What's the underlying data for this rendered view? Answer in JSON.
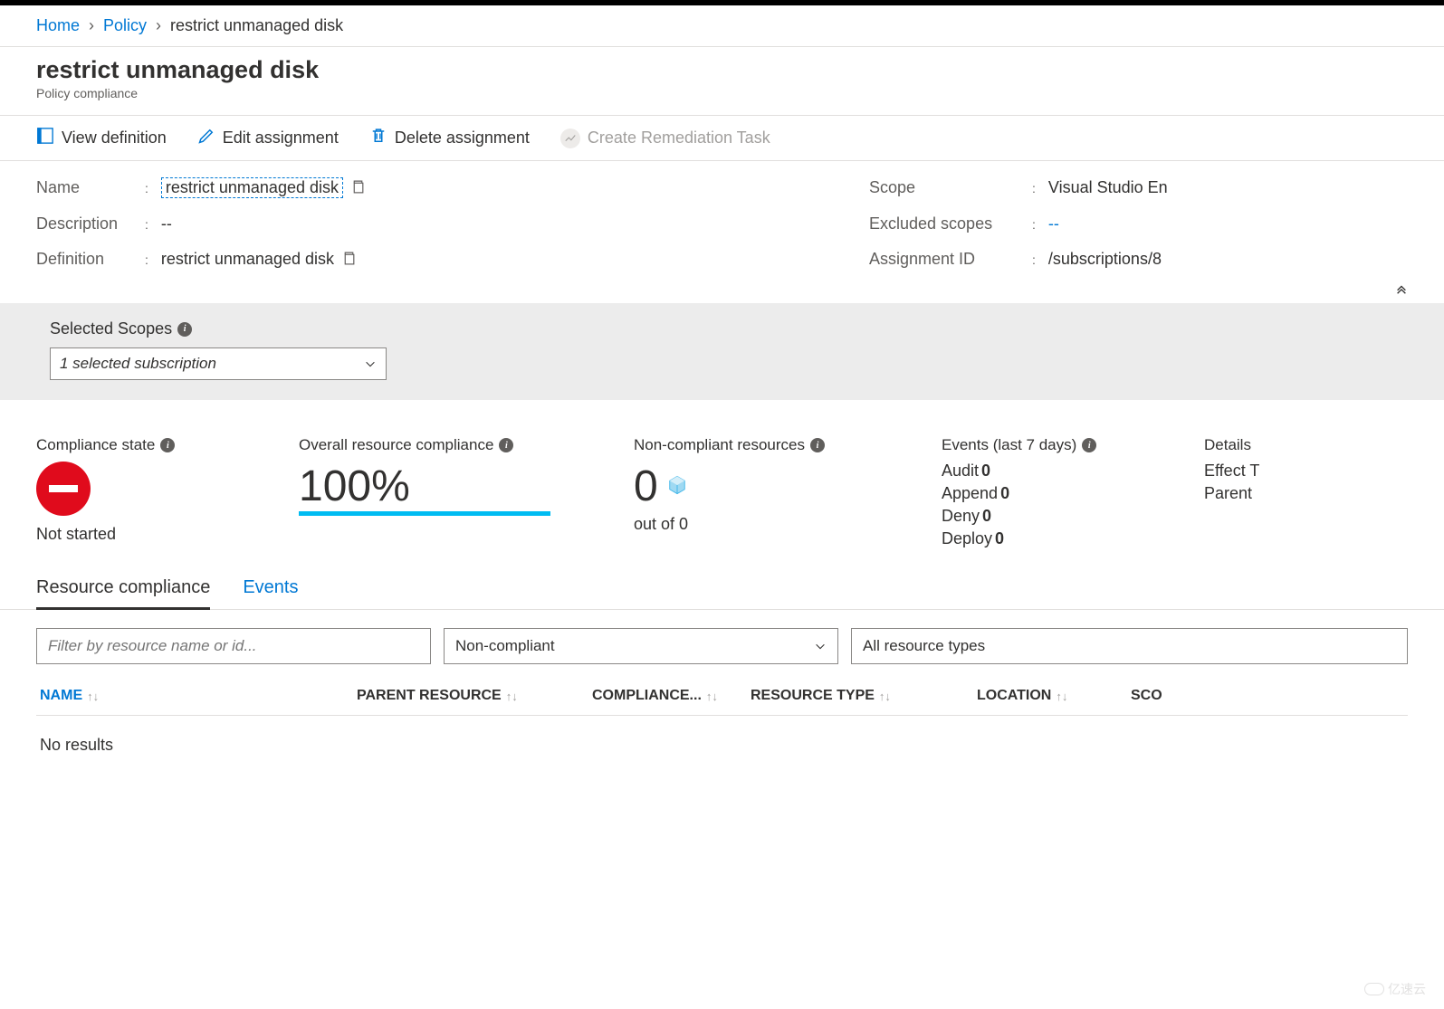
{
  "breadcrumb": {
    "home": "Home",
    "policy": "Policy",
    "current": "restrict unmanaged disk"
  },
  "header": {
    "title": "restrict unmanaged disk",
    "subtitle": "Policy compliance"
  },
  "toolbar": {
    "view_definition": "View definition",
    "edit_assignment": "Edit assignment",
    "delete_assignment": "Delete assignment",
    "create_remediation": "Create Remediation Task"
  },
  "details": {
    "name_label": "Name",
    "name_value": "restrict unmanaged disk",
    "description_label": "Description",
    "description_value": "--",
    "definition_label": "Definition",
    "definition_value": "restrict unmanaged disk",
    "scope_label": "Scope",
    "scope_value": "Visual Studio En",
    "excluded_label": "Excluded scopes",
    "excluded_value": "--",
    "assignment_label": "Assignment ID",
    "assignment_value": "/subscriptions/8"
  },
  "scope_section": {
    "label": "Selected Scopes",
    "dropdown_text": "1 selected subscription"
  },
  "metrics": {
    "compliance_state": {
      "title": "Compliance state",
      "value": "Not started"
    },
    "overall": {
      "title": "Overall resource compliance",
      "value": "100%"
    },
    "noncompliant": {
      "title": "Non-compliant resources",
      "value": "0",
      "subtitle": "out of 0"
    },
    "events": {
      "title": "Events (last 7 days)",
      "items": [
        {
          "label": "Audit",
          "count": "0"
        },
        {
          "label": "Append",
          "count": "0"
        },
        {
          "label": "Deny",
          "count": "0"
        },
        {
          "label": "Deploy",
          "count": "0"
        }
      ]
    },
    "details": {
      "title": "Details",
      "items": [
        {
          "label": "Effect T"
        },
        {
          "label": "Parent"
        }
      ]
    }
  },
  "tabs": {
    "resource_compliance": "Resource compliance",
    "events": "Events"
  },
  "filters": {
    "name_placeholder": "Filter by resource name or id...",
    "compliance_value": "Non-compliant",
    "type_value": "All resource types"
  },
  "table": {
    "columns": {
      "name": "NAME",
      "parent": "PARENT RESOURCE",
      "compliance": "COMPLIANCE...",
      "type": "RESOURCE TYPE",
      "location": "LOCATION",
      "scope": "SCO"
    },
    "empty": "No results"
  },
  "watermark": "亿速云"
}
